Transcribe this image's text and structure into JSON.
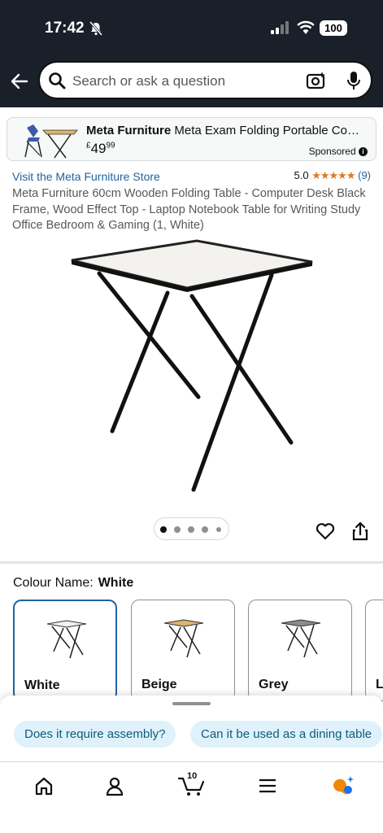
{
  "status": {
    "time": "17:42",
    "battery": "100"
  },
  "search": {
    "placeholder": "Search or ask a question"
  },
  "sponsored": {
    "brand": "Meta Furniture",
    "title": "Meta Exam Folding Portable Co…",
    "price_symbol": "£",
    "price_whole": "49",
    "price_fraction": "99",
    "label": "Sponsored"
  },
  "product": {
    "store_link": "Visit the Meta Furniture Store",
    "rating_value": "5.0",
    "stars": "★★★★★",
    "rating_count": "(9)",
    "title": "Meta Furniture 60cm Wooden Folding Table - Computer Desk Black Frame, Wood Effect Top - Laptop Notebook Table for Writing Study Office Bedroom & Gaming (1, White)",
    "image_count": 5,
    "active_image": 1
  },
  "colour": {
    "label": "Colour Name:",
    "selected": "White",
    "options": [
      {
        "name": "White",
        "top_color": "#f3f2ee"
      },
      {
        "name": "Beige",
        "top_color": "#d9b66a"
      },
      {
        "name": "Grey",
        "top_color": "#8f8a84"
      },
      {
        "name": "L",
        "top_color": "#ffffff"
      }
    ]
  },
  "questions": [
    "Does it require assembly?",
    "Can it be used as a dining table"
  ],
  "nav": {
    "cart_count": "10"
  },
  "colors": {
    "accent_blue": "#2162a1",
    "dark_bar": "#19202a",
    "star": "#de7921",
    "chip_bg": "#dff2fb"
  }
}
